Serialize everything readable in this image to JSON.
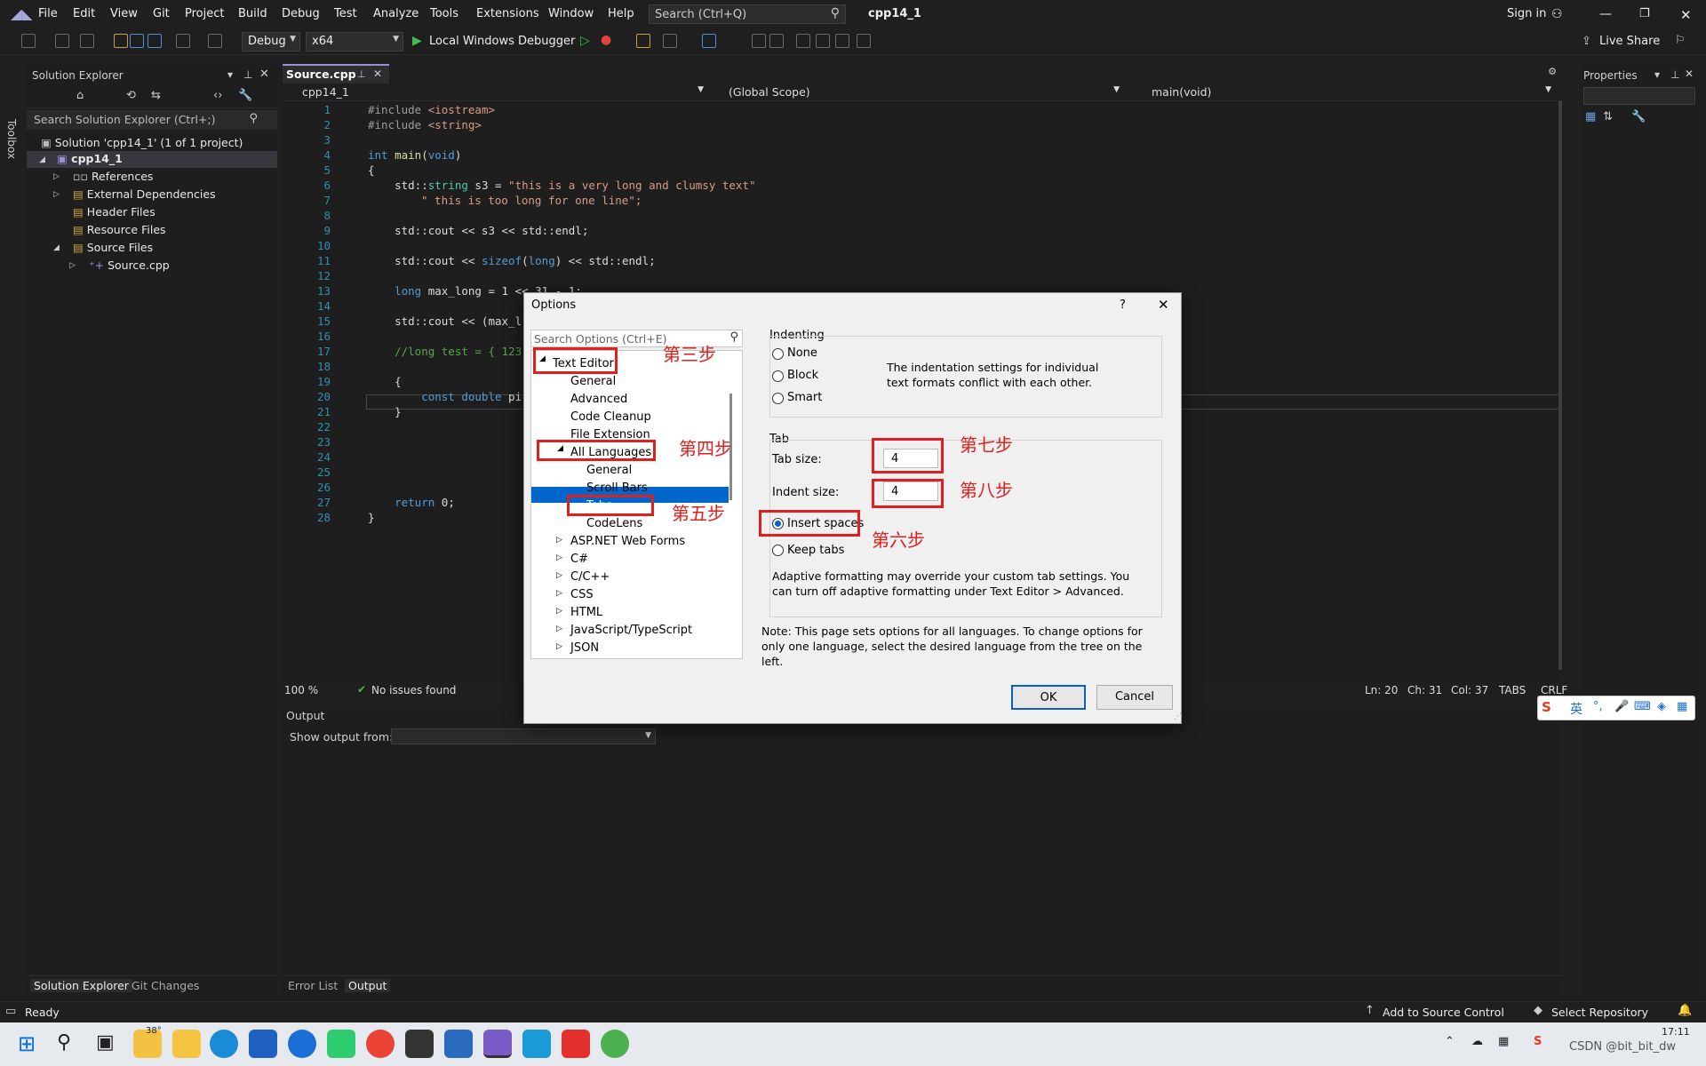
{
  "menu": {
    "items": [
      "File",
      "Edit",
      "View",
      "Git",
      "Project",
      "Build",
      "Debug",
      "Test",
      "Analyze",
      "Tools",
      "Extensions",
      "Window",
      "Help"
    ],
    "search_placeholder": "Search (Ctrl+Q)",
    "project_name": "cpp14_1",
    "sign_in": "Sign in"
  },
  "toolbar": {
    "config": "Debug",
    "platform": "x64",
    "debugger": "Local Windows Debugger",
    "live_share": "Live Share"
  },
  "solution_explorer": {
    "title": "Solution Explorer",
    "search_placeholder": "Search Solution Explorer (Ctrl+;)",
    "solution": "Solution 'cpp14_1' (1 of 1 project)",
    "project": "cpp14_1",
    "items": [
      "References",
      "External Dependencies",
      "Header Files",
      "Resource Files",
      "Source Files"
    ],
    "file": "Source.cpp",
    "tabs": [
      "Solution Explorer",
      "Git Changes"
    ]
  },
  "toolbox_label": "Toolbox",
  "editor": {
    "tab": "Source.cpp",
    "nav_project": "cpp14_1",
    "nav_scope": "(Global Scope)",
    "nav_member": "main(void)",
    "line_numbers": [
      "1",
      "2",
      "3",
      "4",
      "5",
      "6",
      "7",
      "8",
      "9",
      "10",
      "11",
      "12",
      "13",
      "14",
      "15",
      "16",
      "17",
      "18",
      "19",
      "20",
      "21",
      "22",
      "23",
      "24",
      "25",
      "26",
      "27",
      "28"
    ],
    "code": {
      "l1a": "#include ",
      "l1b": "<iostream>",
      "l2a": "#include ",
      "l2b": "<string>",
      "l4a": "int",
      "l4b": " main(",
      "l4c": "void",
      "l4d": ")",
      "l5": "{",
      "l6a": "    std::",
      "l6b": "string",
      "l6c": " s3 = ",
      "l6d": "\"this is a very long and clumsy text\"",
      "l7": "\" this is too long for one line\";",
      "l9": "    std::cout << s3 << std::endl;",
      "l11a": "    std::cout << ",
      "l11b": "sizeof",
      "l11c": "(",
      "l11d": "long",
      "l11e": ") << std::endl;",
      "l13a": "    long",
      "l13b": " max_long = 1 << 31 - 1;",
      "l15": "    std::cout << (max_l",
      "l17": "    //long test = { 123",
      "l19": "    {",
      "l20a": "        const double",
      "l20b": " pi",
      "l21": "    }",
      "l27a": "    return",
      "l27b": " 0;",
      "l28": "}"
    },
    "zoom": "100 %",
    "issues": "No issues found",
    "ln": "Ln: 20",
    "ch": "Ch: 31",
    "col": "Col: 37",
    "tabs_mode": "TABS",
    "eol": "CRLF"
  },
  "output": {
    "title": "Output",
    "show_from": "Show output from:",
    "tabs": [
      "Error List",
      "Output"
    ]
  },
  "properties": {
    "title": "Properties"
  },
  "dialog": {
    "title": "Options",
    "help": "?",
    "search_placeholder": "Search Options (Ctrl+E)",
    "tree": {
      "text_editor": "Text Editor",
      "general": "General",
      "advanced": "Advanced",
      "code_cleanup": "Code Cleanup",
      "file_extension": "File Extension",
      "all_languages": "All Languages",
      "al_general": "General",
      "scroll_bars": "Scroll Bars",
      "tabs": "Tabs",
      "codelens": "CodeLens",
      "aspnet": "ASP.NET Web Forms",
      "csharp": "C#",
      "cpp": "C/C++",
      "css": "CSS",
      "html": "HTML",
      "js": "JavaScript/TypeScript",
      "json": "JSON"
    },
    "indenting": {
      "title": "Indenting",
      "none": "None",
      "block": "Block",
      "smart": "Smart",
      "conflict": "The indentation settings for individual text formats conflict with each other."
    },
    "tab": {
      "title": "Tab",
      "tab_size_label": "Tab size:",
      "tab_size": "4",
      "indent_size_label": "Indent size:",
      "indent_size": "4",
      "insert_spaces": "Insert spaces",
      "keep_tabs": "Keep tabs",
      "adaptive": "Adaptive formatting may override your custom tab settings. You can turn off adaptive formatting under Text Editor > Advanced."
    },
    "note": "Note: This page sets options for all languages. To change options for only one language, select the desired language from the tree on the left.",
    "ok": "OK",
    "cancel": "Cancel"
  },
  "annotations": {
    "step3": "第三步",
    "step4": "第四步",
    "step5": "第五步",
    "step6": "第六步",
    "step7": "第七步",
    "step8": "第八步"
  },
  "status": {
    "ready": "Ready",
    "add_source": "Add to Source Control",
    "select_repo": "Select Repository"
  },
  "taskbar": {
    "temp": "38°",
    "time": "17:11",
    "ime": "英",
    "watermark": "CSDN @bit_bit_dw"
  },
  "colors": {
    "accent": "#0a5fc2",
    "annotation_red": "#e0201e",
    "selected_tree": "#0066cc"
  }
}
